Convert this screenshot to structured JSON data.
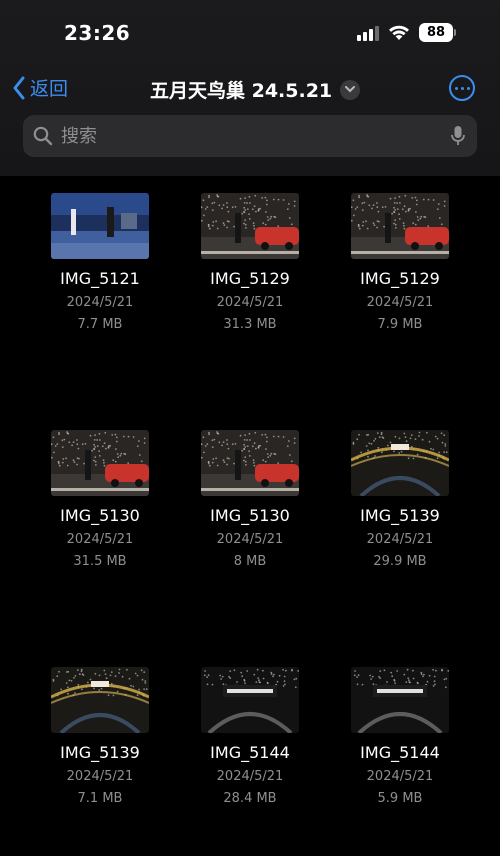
{
  "status": {
    "time": "23:26",
    "battery": "88"
  },
  "nav": {
    "back_label": "返回",
    "title": "五月天鸟巢 24.5.21"
  },
  "search": {
    "placeholder": "搜索"
  },
  "files": [
    {
      "name": "IMG_5121",
      "date": "2024/5/21",
      "size": "7.7 MB",
      "thumb": "stage-blue"
    },
    {
      "name": "IMG_5129",
      "date": "2024/5/21",
      "size": "31.3 MB",
      "thumb": "stage-red-car"
    },
    {
      "name": "IMG_5129",
      "date": "2024/5/21",
      "size": "7.9 MB",
      "thumb": "stage-red-car"
    },
    {
      "name": "IMG_5130",
      "date": "2024/5/21",
      "size": "31.5 MB",
      "thumb": "stage-red-car"
    },
    {
      "name": "IMG_5130",
      "date": "2024/5/21",
      "size": "8 MB",
      "thumb": "stage-red-car"
    },
    {
      "name": "IMG_5139",
      "date": "2024/5/21",
      "size": "29.9 MB",
      "thumb": "stadium-lights"
    },
    {
      "name": "IMG_5139",
      "date": "2024/5/21",
      "size": "7.1 MB",
      "thumb": "stadium-lights"
    },
    {
      "name": "IMG_5144",
      "date": "2024/5/21",
      "size": "28.4 MB",
      "thumb": "stadium-screen"
    },
    {
      "name": "IMG_5144",
      "date": "2024/5/21",
      "size": "5.9 MB",
      "thumb": "stadium-screen"
    }
  ],
  "colors": {
    "accent": "#3b8df0",
    "background": "#000000",
    "header": "#1b1b1d",
    "secondary_text": "#8e8e93"
  }
}
